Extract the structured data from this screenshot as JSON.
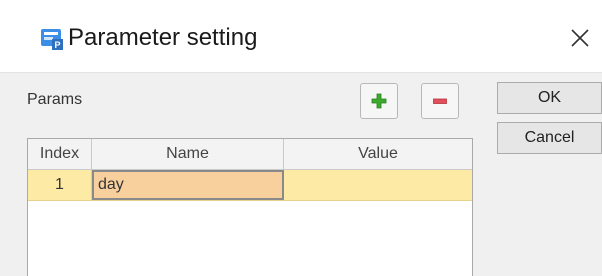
{
  "window": {
    "title": "Parameter setting"
  },
  "params": {
    "label": "Params",
    "columns": [
      "Index",
      "Name",
      "Value"
    ],
    "rows": [
      {
        "index": "1",
        "name": "day",
        "value": ""
      }
    ]
  },
  "buttons": {
    "ok": "OK",
    "cancel": "Cancel"
  },
  "icons": {
    "app": "parameter-app-icon",
    "close": "close-icon",
    "add": "plus-icon",
    "remove": "minus-icon"
  },
  "colors": {
    "selected_row": "#fdeaa4",
    "active_cell": "#f7d09e",
    "add_icon": "#3cab2d",
    "remove_icon": "#e0505a"
  }
}
